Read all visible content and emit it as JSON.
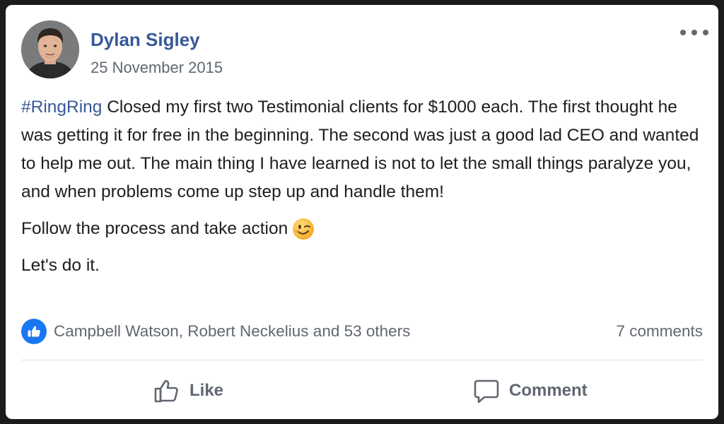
{
  "post": {
    "author": "Dylan Sigley",
    "date": "25 November 2015",
    "hashtag": "#RingRing",
    "paragraph1": " Closed my first two Testimonial clients for $1000 each. The first thought he was getting it for free in the beginning. The second was just a good lad CEO and wanted to help me out. The main thing I have learned is not to let the small things paralyze you, and when problems come up step up and handle them!",
    "paragraph2": "Follow the process and take action",
    "paragraph3": "Let's do it.",
    "emoji": "winking-face-icon",
    "avatar": "profile-photo"
  },
  "reactions": {
    "icon": "thumbs-up-icon",
    "text": "Campbell Watson, Robert Neckelius and 53 others",
    "comments": "7 comments"
  },
  "actions": {
    "like_label": "Like",
    "like_icon": "thumbs-up-outline-icon",
    "comment_label": "Comment",
    "comment_icon": "speech-bubble-icon"
  },
  "menu": {
    "icon": "more-options-icon"
  },
  "colors": {
    "link": "#385898",
    "text": "#1c1e21",
    "muted": "#606770",
    "like_badge": "#1877f2",
    "divider": "#dadde1"
  }
}
